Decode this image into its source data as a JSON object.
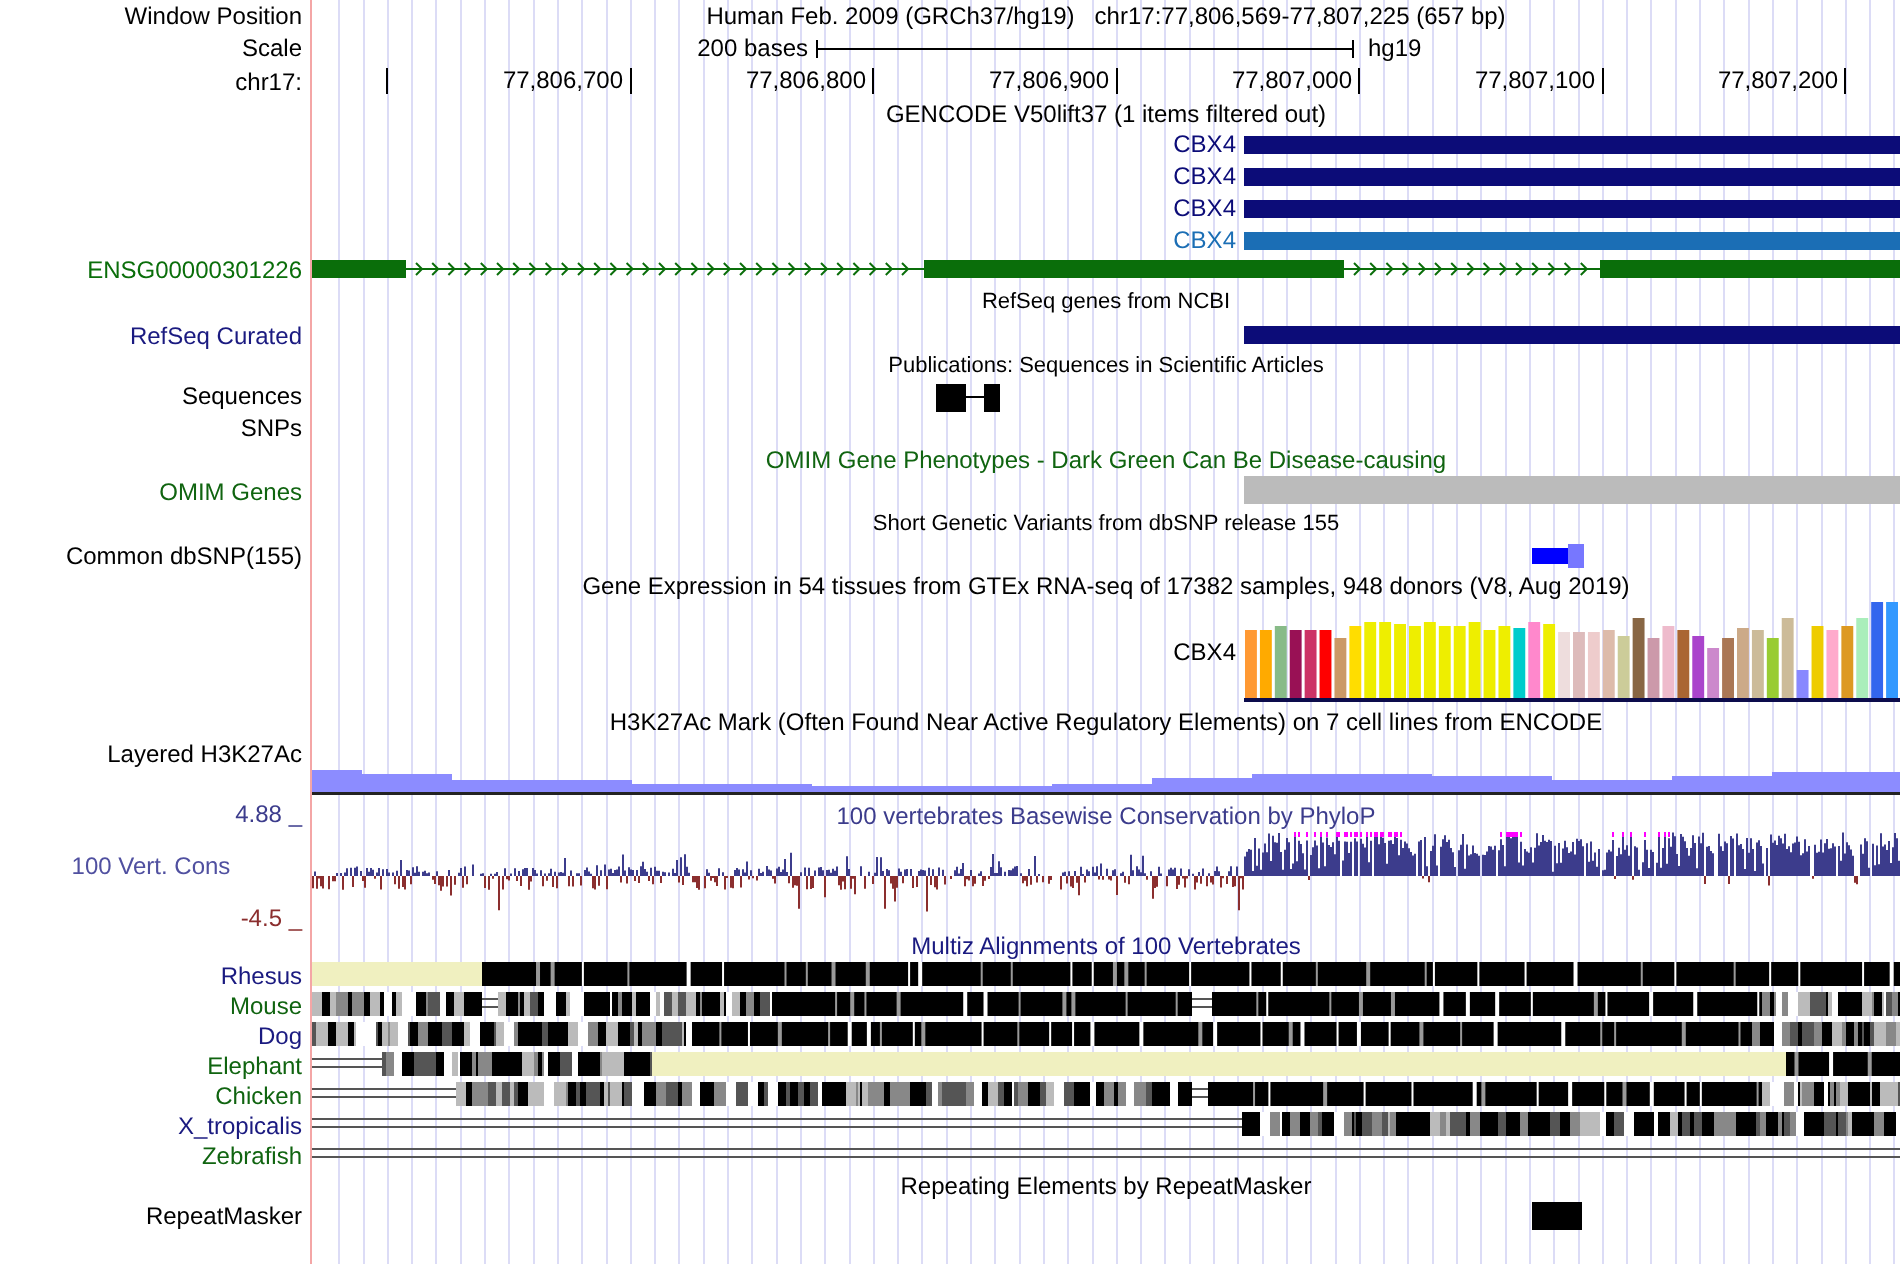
{
  "header": {
    "window_position_label": "Window Position",
    "assembly": "Human Feb. 2009 (GRCh37/hg19)",
    "position": "chr17:77,806,569-77,807,225 (657 bp)",
    "scale_label": "Scale",
    "scale_bar": "200 bases",
    "scale_db": "hg19",
    "chrom_label": "chr17:",
    "ruler_ticks": [
      "77,806,700",
      "77,806,800",
      "77,806,900",
      "77,807,000",
      "77,807,100",
      "77,807,200"
    ]
  },
  "tracks": [
    {
      "kind": "gencode",
      "title": "GENCODE V50lift37 (1 items filtered out)",
      "transcripts": [
        {
          "name": "CBX4",
          "color": "#0c0c78"
        },
        {
          "name": "CBX4",
          "color": "#0c0c78"
        },
        {
          "name": "CBX4",
          "color": "#0c0c78"
        },
        {
          "name": "CBX4",
          "color": "#1b6eb5"
        }
      ]
    },
    {
      "kind": "ensembl",
      "label": "ENSG00000301226"
    },
    {
      "kind": "refseq",
      "title": "RefSeq genes from NCBI",
      "label": "RefSeq Curated"
    },
    {
      "kind": "publications",
      "title": "Publications: Sequences in Scientific Articles",
      "labels": [
        "Sequences",
        "SNPs"
      ]
    },
    {
      "kind": "omim",
      "title": "OMIM Gene Phenotypes - Dark Green Can Be Disease-causing",
      "label": "OMIM Genes"
    },
    {
      "kind": "dbsnp",
      "title": "Short Genetic Variants from dbSNP release 155",
      "label": "Common dbSNP(155)"
    },
    {
      "kind": "gtex",
      "title": "Gene Expression in 54 tissues from GTEx RNA-seq of 17382 samples, 948 donors (V8, Aug 2019)",
      "gene": "CBX4"
    },
    {
      "kind": "h3k27ac",
      "title": "H3K27Ac Mark (Often Found Near Active Regulatory Elements) on 7 cell lines from ENCODE",
      "label": "Layered H3K27Ac"
    },
    {
      "kind": "phylop",
      "title": "100 vertebrates Basewise Conservation by PhyloP",
      "label": "100 Vert. Cons",
      "max": "4.88 _",
      "min": "-4.5 _"
    },
    {
      "kind": "multiz",
      "title": "Multiz Alignments of 100 Vertebrates",
      "species": [
        {
          "name": "Rhesus",
          "color": "#1a1a80"
        },
        {
          "name": "Mouse",
          "color": "#106410"
        },
        {
          "name": "Dog",
          "color": "#1a1a80"
        },
        {
          "name": "Elephant",
          "color": "#106410"
        },
        {
          "name": "Chicken",
          "color": "#106410"
        },
        {
          "name": "X_tropicalis",
          "color": "#1a1a80"
        },
        {
          "name": "Zebrafish",
          "color": "#106410"
        }
      ]
    },
    {
      "kind": "repeatmasker",
      "title": "Repeating Elements by RepeatMasker",
      "label": "RepeatMasker"
    }
  ]
}
